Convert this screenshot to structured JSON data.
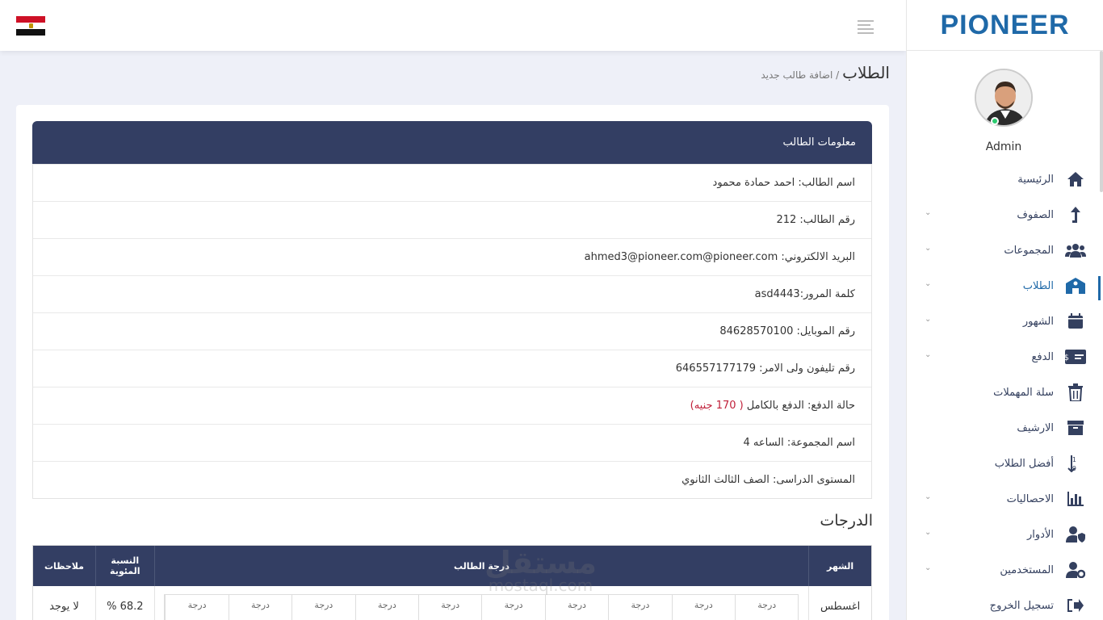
{
  "brand": {
    "logo": "PIONEER"
  },
  "user": {
    "name": "Admin"
  },
  "nav": [
    {
      "label": "الرئيسية",
      "has_arrow": false
    },
    {
      "label": "الصفوف",
      "has_arrow": true
    },
    {
      "label": "المجموعات",
      "has_arrow": true
    },
    {
      "label": "الطلاب",
      "has_arrow": true,
      "active": true
    },
    {
      "label": "الشهور",
      "has_arrow": true
    },
    {
      "label": "الدفع",
      "has_arrow": true
    },
    {
      "label": "سلة المهملات",
      "has_arrow": false
    },
    {
      "label": "الارشيف",
      "has_arrow": false
    },
    {
      "label": "أفضل الطلاب",
      "has_arrow": false
    },
    {
      "label": "الاحصاليات",
      "has_arrow": true
    },
    {
      "label": "الأدوار",
      "has_arrow": true
    },
    {
      "label": "المستخدمين",
      "has_arrow": true
    },
    {
      "label": "تسجيل الخروج",
      "has_arrow": false
    }
  ],
  "page": {
    "title": "الطلاب",
    "breadcrumb": "/ اضافة طالب جديد"
  },
  "info": {
    "header": "معلومات الطالب",
    "rows": [
      {
        "text": "اسم الطالب: احمد حمادة محمود"
      },
      {
        "text": "رقم الطالب: 212"
      },
      {
        "text": "البريد الالكتروني: ahmed3@pioneer.com@pioneer.com"
      },
      {
        "text": "كلمة المرور:asd4443"
      },
      {
        "text": "رقم الموبايل: 84628570100"
      },
      {
        "text": "رقم تليفون ولى الامر: 646557177179"
      },
      {
        "text": "حالة الدفع: الدفع بالكامل",
        "extra": "( 170 جنيه)"
      },
      {
        "text": "اسم المجموعة: الساعه 4"
      },
      {
        "text": "المستوى الدراسى: الصف الثالث الثانوي"
      }
    ]
  },
  "grades": {
    "title": "الدرجات",
    "headers": {
      "month": "الشهر",
      "grade": "درجة الطالب",
      "percent": "النسبة المئوية",
      "notes": "ملاحظات"
    },
    "rows": [
      {
        "month": "اغسطس",
        "percent": "68.2 %",
        "notes": "لا يوجد",
        "sub": [
          "درجة",
          "درجة",
          "درجة",
          "درجة",
          "درجة",
          "درجة",
          "درجة",
          "درجة",
          "درجة",
          "درجة"
        ]
      }
    ]
  },
  "watermark": {
    "ar": "مستقل",
    "en": "mostaql.com"
  },
  "colors": {
    "header_bg": "#333e63",
    "accent": "#1f69a8",
    "payment_red": "#c0203a"
  }
}
